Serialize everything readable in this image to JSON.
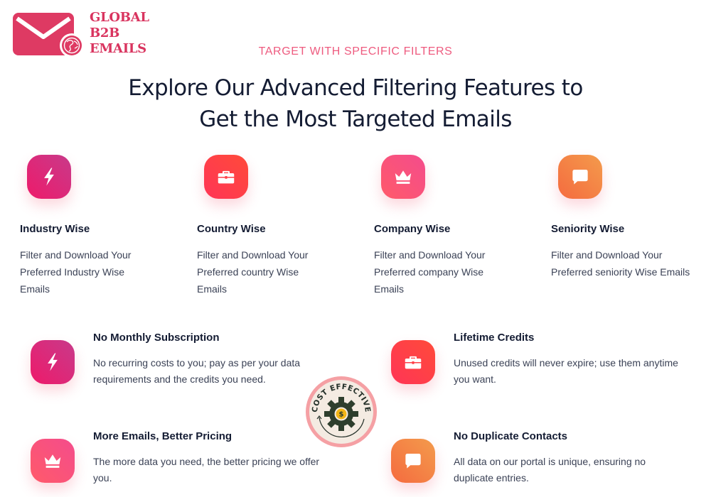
{
  "brand": {
    "lines": [
      "GLOBAL",
      "B2B",
      "EMAILS"
    ],
    "color": "#d9345f",
    "icon": "envelope-globe-icon"
  },
  "eyebrow": "TARGET WITH SPECIFIC FILTERS",
  "headline": {
    "line1": "Explore Our Advanced Filtering Features to",
    "line2": "Get the Most Targeted Emails"
  },
  "filters": [
    {
      "icon": "lightning-icon",
      "title": "Industry Wise",
      "desc_lines": [
        "Filter and Download Your",
        "Preferred Industry Wise",
        "Emails"
      ]
    },
    {
      "icon": "briefcase-icon",
      "title": "Country Wise",
      "desc_lines": [
        "Filter and Download Your",
        "Preferred country Wise",
        "Emails"
      ]
    },
    {
      "icon": "crown-icon",
      "title": "Company Wise",
      "desc_lines": [
        "Filter and Download Your",
        "Preferred company Wise",
        "Emails"
      ]
    },
    {
      "icon": "chat-bubble-icon",
      "title": "Seniority Wise",
      "desc_lines": [
        "Filter and Download Your",
        "Preferred seniority Wise Emails"
      ]
    }
  ],
  "benefits": [
    {
      "icon": "lightning-icon",
      "title": "No Monthly Subscription",
      "desc_lines": [
        "No recurring costs to you; pay as per your data",
        "requirements and the credits you need."
      ]
    },
    {
      "icon": "briefcase-icon",
      "title": "Lifetime Credits",
      "desc_lines": [
        "Unused credits will never expire; use them anytime",
        "you want."
      ]
    },
    {
      "icon": "crown-icon",
      "title": "More Emails, Better Pricing",
      "desc_lines": [
        "The more data you need, the better pricing we offer",
        "you."
      ]
    },
    {
      "icon": "chat-bubble-icon",
      "title": "No Duplicate Contacts",
      "desc_lines": [
        "All data on our portal is unique, ensuring no",
        "duplicate entries."
      ]
    }
  ],
  "badge": {
    "text": "COST EFFECTIVE",
    "symbol": "$",
    "icon": "gear-dollar-icon"
  },
  "colors": {
    "accent": "#ee5b7f",
    "heading": "#141c33",
    "body": "#3b4256"
  }
}
